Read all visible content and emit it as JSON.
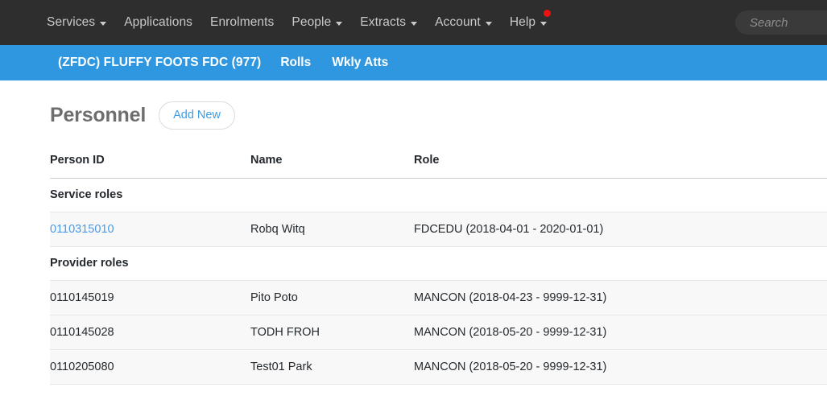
{
  "topnav": {
    "items": [
      {
        "label": "Services",
        "has_caret": true,
        "has_notification": false
      },
      {
        "label": "Applications",
        "has_caret": false,
        "has_notification": false
      },
      {
        "label": "Enrolments",
        "has_caret": false,
        "has_notification": false
      },
      {
        "label": "People",
        "has_caret": true,
        "has_notification": false
      },
      {
        "label": "Extracts",
        "has_caret": true,
        "has_notification": false
      },
      {
        "label": "Account",
        "has_caret": true,
        "has_notification": false
      },
      {
        "label": "Help",
        "has_caret": true,
        "has_notification": true
      }
    ],
    "search": {
      "placeholder": "Search",
      "value": ""
    },
    "background_color": "#2e2e2e",
    "text_color": "#c9c9c9",
    "notification_color": "#ee1111"
  },
  "subnav": {
    "service_title": "(ZFDC) FLUFFY FOOTS FDC (977)",
    "links": [
      {
        "label": "Rolls"
      },
      {
        "label": "Wkly Atts"
      }
    ],
    "background_color": "#2f97e0",
    "text_color": "#ffffff"
  },
  "main": {
    "title": "Personnel",
    "add_new_label": "Add New",
    "accent_color": "#3c9ce3",
    "table": {
      "columns": [
        "Person ID",
        "Name",
        "Role"
      ],
      "groups": [
        {
          "label": "Service roles",
          "rows": [
            {
              "person_id": "0110315010",
              "is_link": true,
              "name": "Robq Witq",
              "role": "FDCEDU (2018-04-01 - 2020-01-01)"
            }
          ]
        },
        {
          "label": "Provider roles",
          "rows": [
            {
              "person_id": "0110145019",
              "is_link": false,
              "name": "Pito Poto",
              "role": "MANCON (2018-04-23 - 9999-12-31)"
            },
            {
              "person_id": "0110145028",
              "is_link": false,
              "name": "TODH FROH",
              "role": "MANCON (2018-05-20 - 9999-12-31)"
            },
            {
              "person_id": "0110205080",
              "is_link": false,
              "name": "Test01 Park",
              "role": "MANCON (2018-05-20 - 9999-12-31)"
            }
          ]
        }
      ]
    }
  }
}
